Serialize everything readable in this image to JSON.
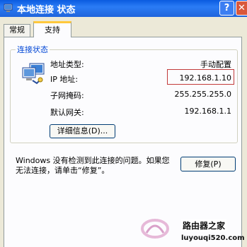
{
  "window": {
    "title": "本地连接 状态",
    "help_label": "?",
    "close_label": "✕"
  },
  "tabs": [
    {
      "label": "常规",
      "selected": false
    },
    {
      "label": "支持",
      "selected": true
    }
  ],
  "connection_status": {
    "group_title": "连接状态",
    "rows": [
      {
        "label": "地址类型:",
        "value": "手动配置"
      },
      {
        "label": "IP 地址:",
        "value": "192.168.1.10"
      },
      {
        "label": "子网掩码:",
        "value": "255.255.255.0"
      },
      {
        "label": "默认网关:",
        "value": "192.168.1.1"
      }
    ],
    "details_button": "详细信息(D)..."
  },
  "repair": {
    "message": "Windows 没有检测到此连接的问题。如果您无法连接，请单击“修复”。",
    "button": "修复(P)"
  },
  "watermark": {
    "text": "路由器之家",
    "url": "luyouqi520.com"
  },
  "icons": {
    "app": "network-connection-icon",
    "status": "network-computer-icon"
  },
  "colors": {
    "titlebar": "#0a5be0",
    "accent": "#0046d5",
    "highlight_box": "#c23a3a",
    "tab_hot": "#ffc83c"
  }
}
